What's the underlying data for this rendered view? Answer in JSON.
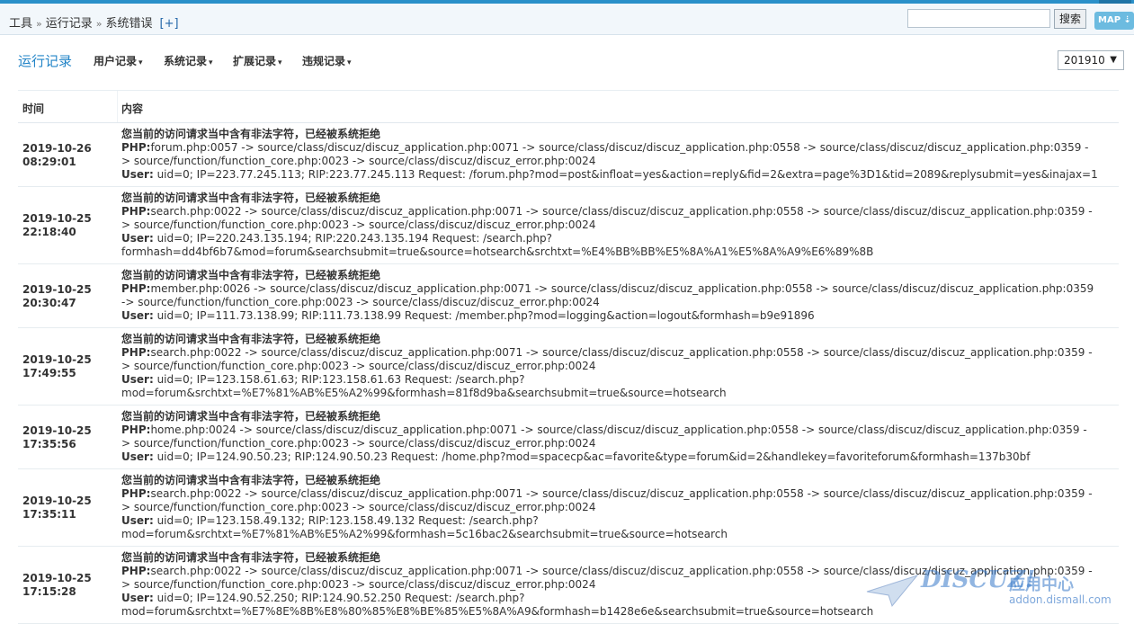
{
  "breadcrumb": {
    "items": [
      "工具",
      "运行记录",
      "系统错误"
    ],
    "separator": "»",
    "add_label": "[+]"
  },
  "search": {
    "value": "",
    "button_label": "搜索"
  },
  "map_button": {
    "label": "MAP ⇣"
  },
  "nav": {
    "title": "运行记录",
    "items": [
      {
        "label": "用户记录"
      },
      {
        "label": "系统记录"
      },
      {
        "label": "扩展记录"
      },
      {
        "label": "违规记录"
      }
    ],
    "caret": "▾"
  },
  "month_select": {
    "value": "201910",
    "caret": "▼"
  },
  "table": {
    "columns": [
      "时间",
      "内容"
    ],
    "rows": [
      {
        "date": "2019-10-26",
        "time": "08:29:01",
        "error": "您当前的访问请求当中含有非法字符，已经被系统拒绝",
        "php_label": "PHP:",
        "php_lines": [
          "forum.php:0057 -> source/class/discuz/discuz_application.php:0071 -> source/class/discuz/discuz_application.php:0558 -> source/class/discuz/discuz_application.php:0359 -",
          "> source/function/function_core.php:0023 -> source/class/discuz/discuz_error.php:0024"
        ],
        "user_label": "User:",
        "user_lines": [
          " uid=0; IP=223.77.245.113; RIP:223.77.245.113 Request: /forum.php?mod=post&infloat=yes&action=reply&fid=2&extra=page%3D1&tid=2089&replysubmit=yes&inajax=1"
        ]
      },
      {
        "date": "2019-10-25",
        "time": "22:18:40",
        "error": "您当前的访问请求当中含有非法字符，已经被系统拒绝",
        "php_label": "PHP:",
        "php_lines": [
          "search.php:0022 -> source/class/discuz/discuz_application.php:0071 -> source/class/discuz/discuz_application.php:0558 -> source/class/discuz/discuz_application.php:0359 -",
          "> source/function/function_core.php:0023 -> source/class/discuz/discuz_error.php:0024"
        ],
        "user_label": "User:",
        "user_lines": [
          " uid=0; IP=220.243.135.194; RIP:220.243.135.194 Request: /search.php?",
          "formhash=dd4bf6b7&mod=forum&searchsubmit=true&source=hotsearch&srchtxt=%E4%BB%BB%E5%8A%A1%E5%8A%A9%E6%89%8B"
        ]
      },
      {
        "date": "2019-10-25",
        "time": "20:30:47",
        "error": "您当前的访问请求当中含有非法字符，已经被系统拒绝",
        "php_label": "PHP:",
        "php_lines": [
          "member.php:0026 -> source/class/discuz/discuz_application.php:0071 -> source/class/discuz/discuz_application.php:0558 -> source/class/discuz/discuz_application.php:0359",
          "-> source/function/function_core.php:0023 -> source/class/discuz/discuz_error.php:0024"
        ],
        "user_label": "User:",
        "user_lines": [
          " uid=0; IP=111.73.138.99; RIP:111.73.138.99 Request: /member.php?mod=logging&action=logout&formhash=b9e91896"
        ]
      },
      {
        "date": "2019-10-25",
        "time": "17:49:55",
        "error": "您当前的访问请求当中含有非法字符，已经被系统拒绝",
        "php_label": "PHP:",
        "php_lines": [
          "search.php:0022 -> source/class/discuz/discuz_application.php:0071 -> source/class/discuz/discuz_application.php:0558 -> source/class/discuz/discuz_application.php:0359 -",
          "> source/function/function_core.php:0023 -> source/class/discuz/discuz_error.php:0024"
        ],
        "user_label": "User:",
        "user_lines": [
          " uid=0; IP=123.158.61.63; RIP:123.158.61.63 Request: /search.php?",
          "mod=forum&srchtxt=%E7%81%AB%E5%A2%99&formhash=81f8d9ba&searchsubmit=true&source=hotsearch"
        ]
      },
      {
        "date": "2019-10-25",
        "time": "17:35:56",
        "error": "您当前的访问请求当中含有非法字符，已经被系统拒绝",
        "php_label": "PHP:",
        "php_lines": [
          "home.php:0024 -> source/class/discuz/discuz_application.php:0071 -> source/class/discuz/discuz_application.php:0558 -> source/class/discuz/discuz_application.php:0359 -",
          "> source/function/function_core.php:0023 -> source/class/discuz/discuz_error.php:0024"
        ],
        "user_label": "User:",
        "user_lines": [
          " uid=0; IP=124.90.50.23; RIP:124.90.50.23 Request: /home.php?mod=spacecp&ac=favorite&type=forum&id=2&handlekey=favoriteforum&formhash=137b30bf"
        ]
      },
      {
        "date": "2019-10-25",
        "time": "17:35:11",
        "error": "您当前的访问请求当中含有非法字符，已经被系统拒绝",
        "php_label": "PHP:",
        "php_lines": [
          "search.php:0022 -> source/class/discuz/discuz_application.php:0071 -> source/class/discuz/discuz_application.php:0558 -> source/class/discuz/discuz_application.php:0359 -",
          "> source/function/function_core.php:0023 -> source/class/discuz/discuz_error.php:0024"
        ],
        "user_label": "User:",
        "user_lines": [
          " uid=0; IP=123.158.49.132; RIP:123.158.49.132 Request: /search.php?",
          "mod=forum&srchtxt=%E7%81%AB%E5%A2%99&formhash=5c16bac2&searchsubmit=true&source=hotsearch"
        ]
      },
      {
        "date": "2019-10-25",
        "time": "17:15:28",
        "error": "您当前的访问请求当中含有非法字符，已经被系统拒绝",
        "php_label": "PHP:",
        "php_lines": [
          "search.php:0022 -> source/class/discuz/discuz_application.php:0071 -> source/class/discuz/discuz_application.php:0558 -> source/class/discuz/discuz_application.php:0359 -",
          "> source/function/function_core.php:0023 -> source/class/discuz/discuz_error.php:0024"
        ],
        "user_label": "User:",
        "user_lines": [
          " uid=0; IP=124.90.52.250; RIP:124.90.52.250 Request: /search.php?",
          "mod=forum&srchtxt=%E7%8E%8B%E8%80%85%E8%BE%85%E5%8A%A9&formhash=b1428e6e&searchsubmit=true&source=hotsearch"
        ]
      }
    ]
  },
  "watermark": {
    "logo": "DISCUZ!",
    "subtitle": "应用中心",
    "domain": "addon.dismall.com"
  },
  "colors": {
    "accent": "#2a90c9",
    "nav_title": "#2284c7",
    "link": "#2366a8"
  }
}
